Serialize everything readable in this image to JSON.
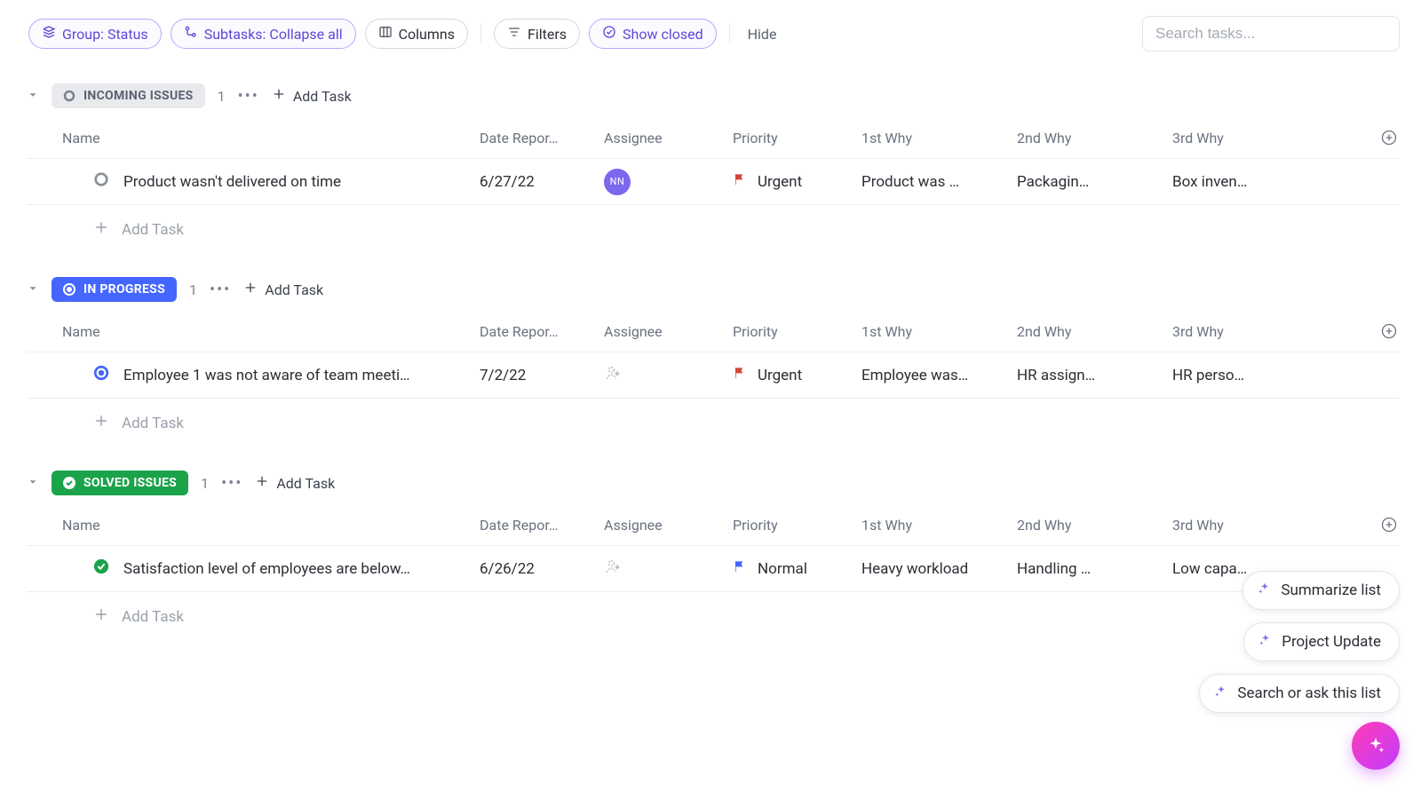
{
  "toolbar": {
    "group_label": "Group: Status",
    "subtasks_label": "Subtasks: Collapse all",
    "columns_label": "Columns",
    "filters_label": "Filters",
    "show_closed_label": "Show closed",
    "hide_label": "Hide",
    "search_placeholder": "Search tasks..."
  },
  "columns": {
    "name": "Name",
    "date": "Date Repor…",
    "assignee": "Assignee",
    "priority": "Priority",
    "why1": "1st Why",
    "why2": "2nd Why",
    "why3": "3rd Why"
  },
  "common": {
    "add_task": "Add Task"
  },
  "groups": [
    {
      "status_label": "INCOMING ISSUES",
      "status_style": "muted",
      "count": "1",
      "rows": [
        {
          "name": "Product wasn't delivered on time",
          "date": "6/27/22",
          "assignee_initials": "NN",
          "assignee_empty": false,
          "priority_label": "Urgent",
          "priority_color": "red",
          "why1": "Product was …",
          "why2": "Packagin…",
          "why3": "Box inven…",
          "status_icon": "grey"
        }
      ]
    },
    {
      "status_label": "IN PROGRESS",
      "status_style": "blue",
      "count": "1",
      "rows": [
        {
          "name": "Employee 1 was not aware of team meeti…",
          "date": "7/2/22",
          "assignee_initials": "",
          "assignee_empty": true,
          "priority_label": "Urgent",
          "priority_color": "red",
          "why1": "Employee was…",
          "why2": "HR assign…",
          "why3": "HR perso…",
          "status_icon": "blue"
        }
      ]
    },
    {
      "status_label": "SOLVED ISSUES",
      "status_style": "green",
      "count": "1",
      "rows": [
        {
          "name": "Satisfaction level of employees are below…",
          "date": "6/26/22",
          "assignee_initials": "",
          "assignee_empty": true,
          "priority_label": "Normal",
          "priority_color": "blue",
          "why1": "Heavy workload",
          "why2": "Handling …",
          "why3": "Low capa…",
          "status_icon": "green"
        }
      ]
    }
  ],
  "ai": {
    "summarize": "Summarize list",
    "project_update": "Project Update",
    "search_ask": "Search or ask this list"
  }
}
